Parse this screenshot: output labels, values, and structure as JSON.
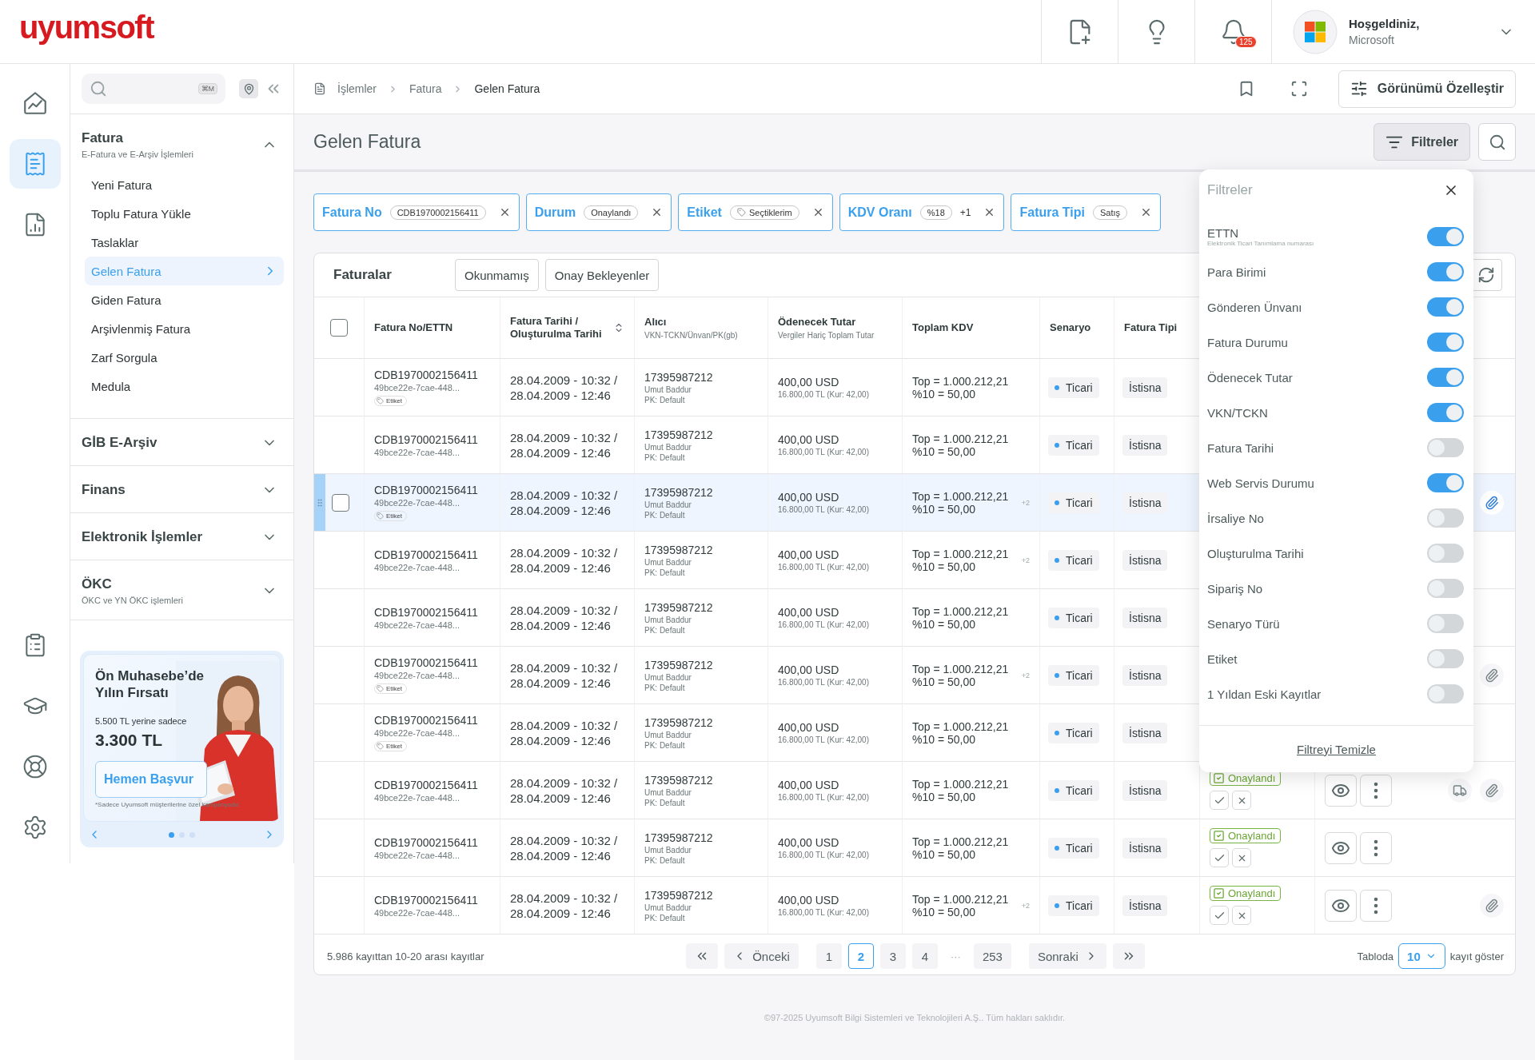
{
  "header": {
    "logo": "uyumsoft",
    "icons": [
      {
        "kind": "note"
      },
      {
        "kind": "idea"
      },
      {
        "kind": "bell",
        "badge": "125"
      }
    ],
    "user": {
      "greeting": "Hoşgeldiniz,",
      "company": "Microsoft"
    }
  },
  "rail": {
    "top": [
      {
        "kind": "home",
        "selected": false
      },
      {
        "kind": "invoice",
        "selected": true
      },
      {
        "kind": "report",
        "selected": false
      }
    ],
    "bottom": [
      {
        "kind": "favorites",
        "selected": false
      },
      {
        "kind": "academy",
        "selected": false
      },
      {
        "kind": "support",
        "selected": false
      },
      {
        "kind": "settings",
        "selected": false
      }
    ]
  },
  "sidebar": {
    "search": {
      "shortcut": "⌘M"
    },
    "sections": [
      {
        "title": "Fatura",
        "subtitle": "E-Fatura ve E-Arşiv İşlemleri",
        "expanded": true,
        "items": [
          {
            "label": "Yeni Fatura",
            "selected": false
          },
          {
            "label": "Toplu Fatura Yükle",
            "selected": false
          },
          {
            "label": "Taslaklar",
            "selected": false
          },
          {
            "label": "Gelen Fatura",
            "selected": true
          },
          {
            "label": "Giden Fatura",
            "selected": false
          },
          {
            "label": "Arşivlenmiş Fatura",
            "selected": false
          },
          {
            "label": "Zarf Sorgula",
            "selected": false
          },
          {
            "label": "Medula",
            "selected": false
          }
        ]
      },
      {
        "title": "GİB E-Arşiv",
        "expanded": false
      },
      {
        "title": "Finans",
        "expanded": false
      },
      {
        "title": "Elektronik İşlemler",
        "expanded": false
      },
      {
        "title": "ÖKC",
        "subtitle": "ÖKC ve YN ÖKC işlemleri",
        "expanded": false
      }
    ]
  },
  "promo": {
    "title": "Ön Muhasebe’de Yılın Fırsatı",
    "old_price": "5.500 TL yerine sadece",
    "price": "3.300 TL",
    "button": "Hemen Başvur",
    "note": "*Sadece Uyumsoft müşterilerine özel kampanyadır.",
    "slides": [
      {
        "selected": true
      },
      {
        "selected": false
      },
      {
        "selected": false
      }
    ]
  },
  "breadcrumb": [
    "İşlemler",
    "Fatura",
    "Gelen Fatura"
  ],
  "customize_button": "Görünümü Özelleştir",
  "page": {
    "title": "Gelen Fatura",
    "filter_button": {
      "label": "Filtreler",
      "selected": true
    }
  },
  "chips": [
    {
      "label": "Fatura No",
      "value": "CDB1970002156411",
      "kind": "text"
    },
    {
      "label": "Durum",
      "value": "Onaylandı",
      "kind": "text"
    },
    {
      "label": "Etiket",
      "value": "Seçtiklerim",
      "kind": "tag"
    },
    {
      "label": "KDV Oranı",
      "value": "%18",
      "more": "+1",
      "kind": "text"
    },
    {
      "label": "Fatura Tipi",
      "value": "Satış",
      "kind": "text"
    }
  ],
  "table": {
    "title": "Faturalar",
    "tabs": [
      {
        "label": "Okunmamış",
        "selected": false
      },
      {
        "label": "Onay Bekleyenler",
        "selected": false
      }
    ],
    "header_checkbox": {
      "checked": false
    },
    "columns": [
      {
        "title": "Fatura No/ETTN"
      },
      {
        "title": "Fatura Tarihi / Oluşturulma Tarihi",
        "sortable": true
      },
      {
        "title": "Alıcı",
        "subtitle": "VKN-TCKN/Ünvan/PK(gb)"
      },
      {
        "title": "Ödenecek Tutar",
        "subtitle": "Vergiler Hariç Toplam Tutar"
      },
      {
        "title": "Toplam KDV"
      },
      {
        "title": "Senaryo"
      },
      {
        "title": "Fatura Tipi"
      }
    ],
    "rows": [
      {
        "no": "CDB1970002156411",
        "ettn": "49bce22e-7cae-448...",
        "tag": "Etiket",
        "date": "28.04.2009 - 10:32 /",
        "created": "28.04.2009 - 12:46",
        "vkn": "17395987212",
        "name": "Umut Baddur",
        "pk": "PK: Default",
        "amount": "400,00 USD",
        "amount_tl": "16.800,00 TL (Kur: 42,00)",
        "kdv_total": "Top = 1.000.212,21",
        "kdv_rate": "%10 = 50,00",
        "scenario": "Ticari",
        "type": "İstisna",
        "highlighted": false,
        "icons": []
      },
      {
        "no": "CDB1970002156411",
        "ettn": "49bce22e-7cae-448...",
        "date": "28.04.2009 - 10:32 /",
        "created": "28.04.2009 - 12:46",
        "vkn": "17395987212",
        "name": "Umut Baddur",
        "pk": "PK: Default",
        "amount": "400,00 USD",
        "amount_tl": "16.800,00 TL (Kur: 42,00)",
        "kdv_total": "Top = 1.000.212,21",
        "kdv_rate": "%10 = 50,00",
        "scenario": "Ticari",
        "type": "İstisna",
        "highlighted": false,
        "icons": []
      },
      {
        "no": "CDB1970002156411",
        "ettn": "49bce22e-7cae-448...",
        "tag": "Etiket",
        "date": "28.04.2009 - 10:32 /",
        "created": "28.04.2009 - 12:46",
        "vkn": "17395987212",
        "name": "Umut Baddur",
        "pk": "PK: Default",
        "amount": "400,00 USD",
        "amount_tl": "16.800,00 TL (Kur: 42,00)",
        "kdv_total": "Top = 1.000.212,21",
        "kdv_rate": "%10 = 50,00",
        "kdv_more": "+2",
        "scenario": "Ticari",
        "type": "İstisna",
        "highlighted": true,
        "checked": false,
        "icons": [
          {
            "kind": "clip"
          }
        ]
      },
      {
        "no": "CDB1970002156411",
        "ettn": "49bce22e-7cae-448...",
        "date": "28.04.2009 - 10:32 /",
        "created": "28.04.2009 - 12:46",
        "vkn": "17395987212",
        "name": "Umut Baddur",
        "pk": "PK: Default",
        "amount": "400,00 USD",
        "amount_tl": "16.800,00 TL (Kur: 42,00)",
        "kdv_total": "Top = 1.000.212,21",
        "kdv_rate": "%10 = 50,00",
        "kdv_more": "+2",
        "scenario": "Ticari",
        "type": "İstisna",
        "highlighted": false,
        "icons": []
      },
      {
        "no": "CDB1970002156411",
        "ettn": "49bce22e-7cae-448...",
        "date": "28.04.2009 - 10:32 /",
        "created": "28.04.2009 - 12:46",
        "vkn": "17395987212",
        "name": "Umut Baddur",
        "pk": "PK: Default",
        "amount": "400,00 USD",
        "amount_tl": "16.800,00 TL (Kur: 42,00)",
        "kdv_total": "Top = 1.000.212,21",
        "kdv_rate": "%10 = 50,00",
        "scenario": "Ticari",
        "type": "İstisna",
        "highlighted": false,
        "icons": []
      },
      {
        "no": "CDB1970002156411",
        "ettn": "49bce22e-7cae-448...",
        "tag": "Etiket",
        "date": "28.04.2009 - 10:32 /",
        "created": "28.04.2009 - 12:46",
        "vkn": "17395987212",
        "name": "Umut Baddur",
        "pk": "PK: Default",
        "amount": "400,00 USD",
        "amount_tl": "16.800,00 TL (Kur: 42,00)",
        "kdv_total": "Top = 1.000.212,21",
        "kdv_rate": "%10 = 50,00",
        "kdv_more": "+2",
        "scenario": "Ticari",
        "type": "İstisna",
        "highlighted": false,
        "icons": [
          {
            "kind": "clip"
          }
        ]
      },
      {
        "no": "CDB1970002156411",
        "ettn": "49bce22e-7cae-448...",
        "tag": "Etiket",
        "date": "28.04.2009 - 10:32 /",
        "created": "28.04.2009 - 12:46",
        "vkn": "17395987212",
        "name": "Umut Baddur",
        "pk": "PK: Default",
        "amount": "400,00 USD",
        "amount_tl": "16.800,00 TL (Kur: 42,00)",
        "kdv_total": "Top = 1.000.212,21",
        "kdv_rate": "%10 = 50,00",
        "scenario": "Ticari",
        "type": "İstisna",
        "highlighted": false,
        "icons": []
      },
      {
        "no": "CDB1970002156411",
        "ettn": "49bce22e-7cae-448...",
        "date": "28.04.2009 - 10:32 /",
        "created": "28.04.2009 - 12:46",
        "vkn": "17395987212",
        "name": "Umut Baddur",
        "pk": "PK: Default",
        "amount": "400,00 USD",
        "amount_tl": "16.800,00 TL (Kur: 42,00)",
        "kdv_total": "Top = 1.000.212,21",
        "kdv_rate": "%10 = 50,00",
        "scenario": "Ticari",
        "type": "İstisna",
        "highlighted": false,
        "status": "Onaylandı",
        "icons": [
          {
            "kind": "truck"
          },
          {
            "kind": "clip"
          }
        ]
      },
      {
        "no": "CDB1970002156411",
        "ettn": "49bce22e-7cae-448...",
        "date": "28.04.2009 - 10:32 /",
        "created": "28.04.2009 - 12:46",
        "vkn": "17395987212",
        "name": "Umut Baddur",
        "pk": "PK: Default",
        "amount": "400,00 USD",
        "amount_tl": "16.800,00 TL (Kur: 42,00)",
        "kdv_total": "Top = 1.000.212,21",
        "kdv_rate": "%10 = 50,00",
        "scenario": "Ticari",
        "type": "İstisna",
        "highlighted": false,
        "status": "Onaylandı",
        "icons": []
      },
      {
        "no": "CDB1970002156411",
        "ettn": "49bce22e-7cae-448...",
        "date": "28.04.2009 - 10:32 /",
        "created": "28.04.2009 - 12:46",
        "vkn": "17395987212",
        "name": "Umut Baddur",
        "pk": "PK: Default",
        "amount": "400,00 USD",
        "amount_tl": "16.800,00 TL (Kur: 42,00)",
        "kdv_total": "Top = 1.000.212,21",
        "kdv_rate": "%10 = 50,00",
        "kdv_more": "+2",
        "scenario": "Ticari",
        "type": "İstisna",
        "highlighted": false,
        "status": "Onaylandı",
        "icons": [
          {
            "kind": "clip"
          }
        ]
      }
    ]
  },
  "pagination": {
    "summary": "5.986 kayıttan 10-20 arası kayıtlar",
    "prev": "Önceki",
    "next": "Sonraki",
    "pages": [
      {
        "label": "1",
        "kind": "page",
        "selected": false
      },
      {
        "label": "2",
        "kind": "page",
        "selected": true
      },
      {
        "label": "3",
        "kind": "page",
        "selected": false
      },
      {
        "label": "4",
        "kind": "page",
        "selected": false
      },
      {
        "label": "···",
        "kind": "gap"
      },
      {
        "label": "253",
        "kind": "page",
        "selected": false
      }
    ],
    "page_size": {
      "label": "Tabloda",
      "value": "10",
      "suffix": "kayıt göster"
    }
  },
  "footer": "©97-2025 Uyumsoft Bilgi Sistemleri ve Teknolojileri A.Ş.. Tüm hakları saklıdır.",
  "filter_panel": {
    "title": "Filtreler",
    "toggles": [
      {
        "label": "ETTN",
        "hint": "Elektronik Ticari Tanımlama numarası",
        "on": true
      },
      {
        "label": "Para Birimi",
        "on": true
      },
      {
        "label": "Gönderen Ünvanı",
        "on": true
      },
      {
        "label": "Fatura Durumu",
        "on": true
      },
      {
        "label": "Ödenecek Tutar",
        "on": true
      },
      {
        "label": "VKN/TCKN",
        "on": true
      },
      {
        "label": "Fatura Tarihi",
        "on": false
      },
      {
        "label": "Web Servis Durumu",
        "on": true
      },
      {
        "label": "İrsaliye No",
        "on": false
      },
      {
        "label": "Oluşturulma Tarihi",
        "on": false
      },
      {
        "label": "Sipariş No",
        "on": false
      },
      {
        "label": "Senaryo Türü",
        "on": false
      },
      {
        "label": "Etiket",
        "on": false
      },
      {
        "label": "1 Yıldan Eski Kayıtlar",
        "on": false
      }
    ],
    "clear": "Filtreyi Temizle"
  }
}
